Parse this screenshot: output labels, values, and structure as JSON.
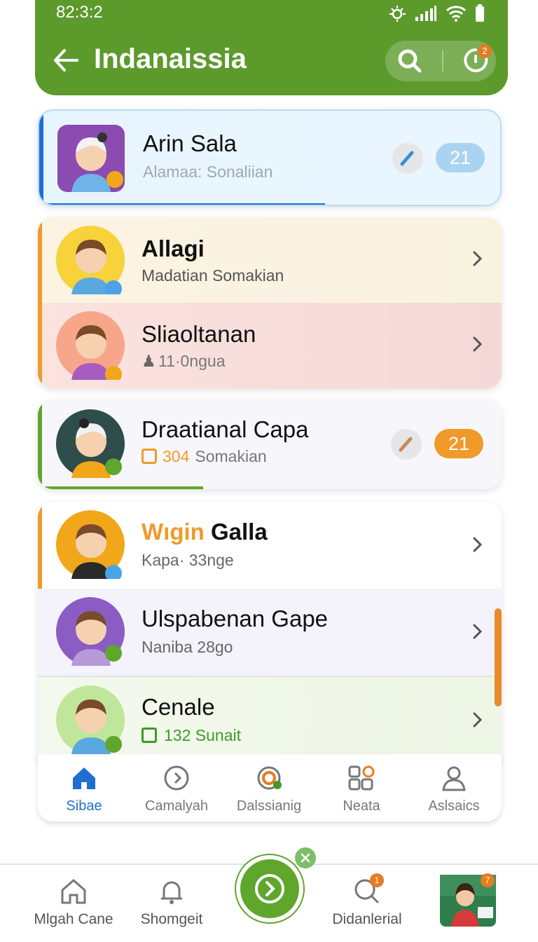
{
  "status_bar": {
    "time": "82:3:2"
  },
  "header": {
    "title": "Indanaissia",
    "timer_badge": "2"
  },
  "contacts": [
    {
      "name": "Arin Sala",
      "subtitle": "Alamaa: Sonaliian",
      "count": "21"
    },
    {
      "name": "Allagi",
      "subtitle": "Madatian Somakian"
    },
    {
      "name": "Sliaoltanan",
      "subtitle": "11·0ngua"
    },
    {
      "name": "Draatianal Capa",
      "subtitle_num": "304",
      "subtitle": "Somakian",
      "count": "21"
    },
    {
      "name_highlight": "Wıgin",
      "name": "Galla",
      "subtitle": "Kapa· 33nge"
    },
    {
      "name": "Ulspabenan Gape",
      "subtitle": "Naniba 28go"
    },
    {
      "name": "Cenale",
      "subtitle": "132 Sunait"
    }
  ],
  "tabs": [
    {
      "label": "Sibae",
      "icon": "home-icon"
    },
    {
      "label": "Camalyah",
      "icon": "clock-icon"
    },
    {
      "label": "Dalssianig",
      "icon": "target-icon"
    },
    {
      "label": "Neata",
      "icon": "grid-icon"
    },
    {
      "label": "Aslsaics",
      "icon": "person-icon"
    }
  ],
  "bottom_nav": [
    {
      "label": "Mlgah Cane",
      "icon": "home-outline-icon"
    },
    {
      "label": "Shomgeit",
      "icon": "bell-icon"
    },
    {
      "label": "Didanlerial",
      "icon": "chat-search-icon",
      "badge": "1"
    },
    {
      "label": "",
      "icon": "profile-photo",
      "badge": "7"
    }
  ],
  "colors": {
    "primary": "#5c9a2c",
    "blue": "#1f6fd1",
    "orange": "#ef9a2a",
    "count_blue": "#a9d3f0"
  }
}
